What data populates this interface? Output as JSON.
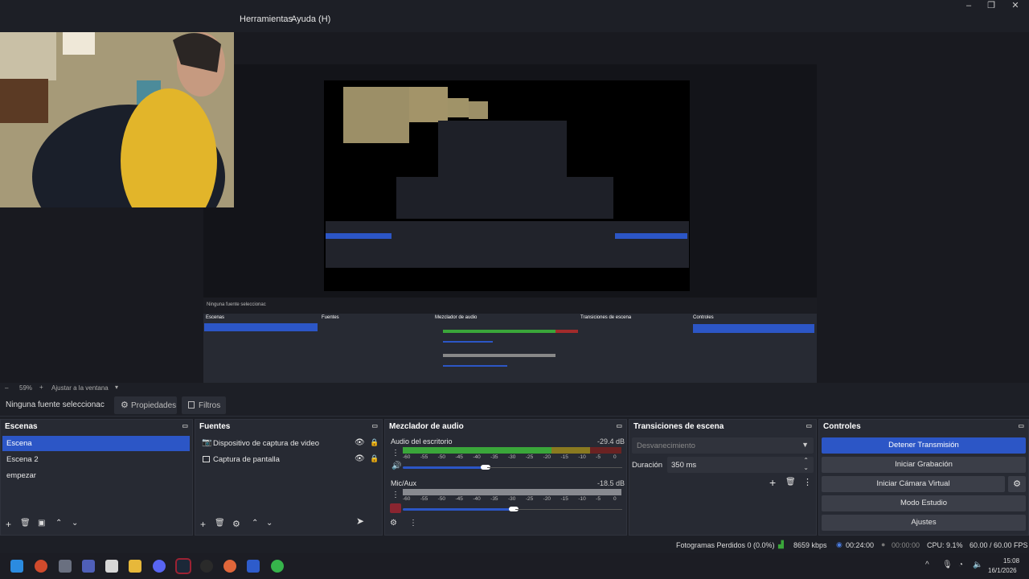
{
  "menu": {
    "tools": "Herramientas",
    "help": "Ayuda (H)"
  },
  "window": {
    "minimize": "–",
    "maximize": "❐",
    "close": "✕"
  },
  "zoom": {
    "minus": "–",
    "value": "59%",
    "plus": "+",
    "fit": "Ajustar a la ventana"
  },
  "source_bar": {
    "selected": "Ninguna fuente seleccionac",
    "properties": "Propiedades",
    "filters": "Filtros"
  },
  "scenes": {
    "title": "Escenas",
    "items": [
      "Escena",
      "Escena 2",
      "empezar"
    ]
  },
  "sources": {
    "title": "Fuentes",
    "items": [
      "Dispositivo de captura de video",
      "Captura de pantalla"
    ]
  },
  "mixer": {
    "title": "Mezclador de audio",
    "channels": [
      {
        "name": "Audio del escritorio",
        "db": "-29.4 dB",
        "level": 0.6,
        "volume": 0.55
      },
      {
        "name": "Mic/Aux",
        "db": "-18.5 dB",
        "level": 0.0,
        "volume": 0.6
      }
    ],
    "ticks": [
      "-60",
      "-55",
      "-50",
      "-45",
      "-40",
      "-35",
      "-30",
      "-25",
      "-20",
      "-15",
      "-10",
      "-5",
      "0"
    ]
  },
  "transitions": {
    "title": "Transiciones de escena",
    "select": "Desvanecimiento",
    "duration_label": "Duración",
    "duration_value": "350 ms"
  },
  "controls": {
    "title": "Controles",
    "stop_stream": "Detener Transmisión",
    "start_recording": "Iniciar Grabación",
    "start_virtual_cam": "Iniciar Cámara Virtual",
    "studio_mode": "Modo Estudio",
    "settings": "Ajustes"
  },
  "status": {
    "dropped": "Fotogramas Perdidos 0 (0.0%)",
    "bitrate": "8659 kbps",
    "stream_time": "00:24:00",
    "rec_time": "00:00:00",
    "cpu": "CPU: 9.1%",
    "fps": "60.00 / 60.00 FPS"
  },
  "clock": {
    "time": "15:08",
    "date": "16/1/2026"
  },
  "colors": {
    "accent": "#2c56c6",
    "meter_green": "#3aa63a",
    "meter_yellow": "#b59a22",
    "meter_red": "#a32b2b"
  }
}
